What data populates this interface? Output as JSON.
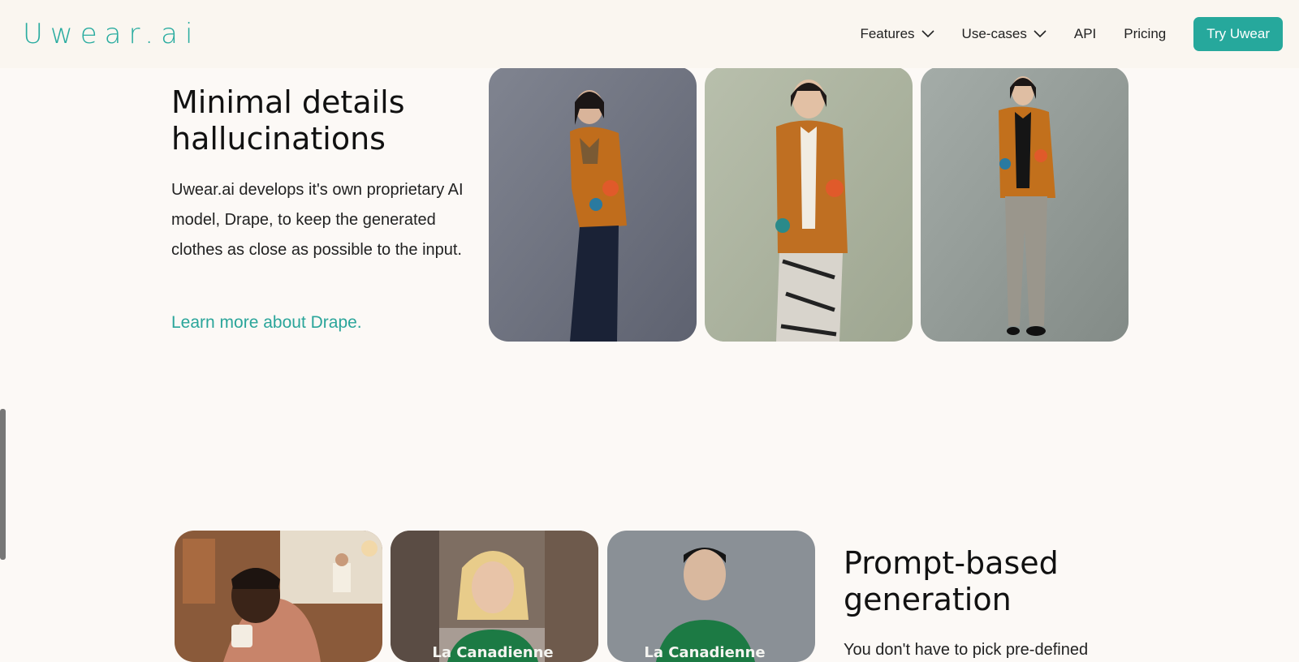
{
  "header": {
    "logo": "Uwear.ai",
    "nav": [
      {
        "label": "Features",
        "has_dropdown": true
      },
      {
        "label": "Use-cases",
        "has_dropdown": true
      },
      {
        "label": "API",
        "has_dropdown": false
      },
      {
        "label": "Pricing",
        "has_dropdown": false
      }
    ],
    "cta_label": "Try Uwear"
  },
  "section1": {
    "title": "Minimal details hallucinations",
    "description": "Uwear.ai develops it's own proprietary AI model, Drape, to keep the generated clothes as close as possible to the input.",
    "link": "Learn more about Drape."
  },
  "section2": {
    "title": "Prompt-based generation",
    "description": "You don't have to pick pre-defined"
  },
  "photos": {
    "shirt_print": "La Canadienne"
  },
  "colors": {
    "accent": "#26a89c",
    "header_bg": "#faf6f0",
    "page_bg": "#fcf9f6"
  }
}
